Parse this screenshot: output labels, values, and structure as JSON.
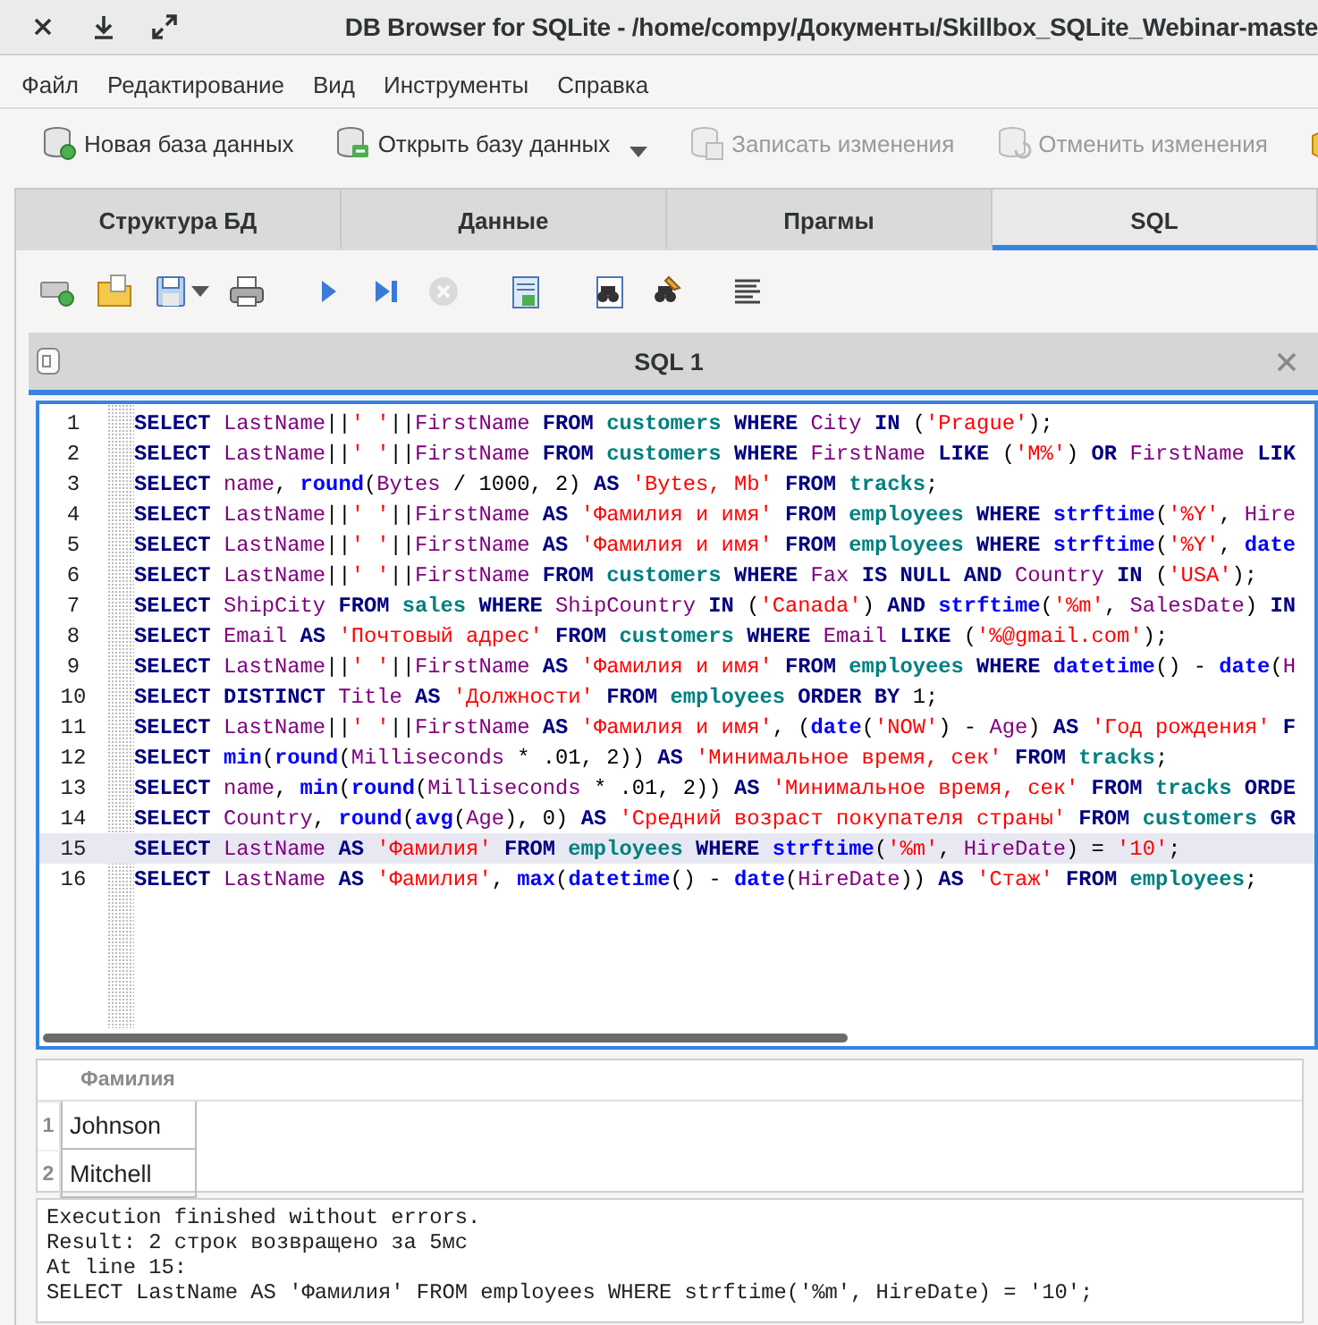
{
  "window": {
    "title": "DB Browser for SQLite - /home/compy/Документы/Skillbox_SQLite_Webinar-maste"
  },
  "menu": [
    "Файл",
    "Редактирование",
    "Вид",
    "Инструменты",
    "Справка"
  ],
  "toolbar": [
    {
      "kind": "new-db",
      "label": "Новая база данных",
      "disabled": false,
      "dropdown": false
    },
    {
      "kind": "open-db",
      "label": "Открыть базу данных",
      "disabled": false,
      "dropdown": true
    },
    {
      "kind": "write",
      "label": "Записать изменения",
      "disabled": true,
      "dropdown": false
    },
    {
      "kind": "revert",
      "label": "Отменить изменения",
      "disabled": true,
      "dropdown": false
    },
    {
      "kind": "project",
      "disabled": false,
      "dropdown": false
    }
  ],
  "tabs": [
    {
      "label": "Структура БД",
      "selected": false
    },
    {
      "label": "Данные",
      "selected": false
    },
    {
      "label": "Прагмы",
      "selected": false
    },
    {
      "label": "SQL",
      "selected": true
    }
  ],
  "editor_toolbar": [
    {
      "kind": "open-tab",
      "disabled": false,
      "dropdown": false
    },
    {
      "kind": "open-file",
      "disabled": false,
      "dropdown": false
    },
    {
      "kind": "save-file",
      "disabled": false,
      "dropdown": true
    },
    {
      "kind": "print",
      "disabled": false,
      "dropdown": false
    },
    {
      "kind": "execute",
      "disabled": false,
      "dropdown": false
    },
    {
      "kind": "execute-line",
      "disabled": false,
      "dropdown": false
    },
    {
      "kind": "stop",
      "disabled": true,
      "dropdown": false
    },
    {
      "kind": "save-results",
      "disabled": false,
      "dropdown": false
    },
    {
      "kind": "find",
      "disabled": false,
      "dropdown": false
    },
    {
      "kind": "replace",
      "disabled": false,
      "dropdown": false
    },
    {
      "kind": "comment",
      "disabled": false,
      "dropdown": false
    }
  ],
  "sql_tab": {
    "label": "SQL 1"
  },
  "editor": {
    "lines": [
      {
        "number": "1",
        "current": false,
        "tokens": [
          {
            "kind": "keyword",
            "text": "SELECT "
          },
          {
            "kind": "name",
            "text": "LastName"
          },
          {
            "kind": "plain",
            "text": "||"
          },
          {
            "kind": "string",
            "text": "' '"
          },
          {
            "kind": "plain",
            "text": "||"
          },
          {
            "kind": "name",
            "text": "FirstName "
          },
          {
            "kind": "keyword",
            "text": "FROM "
          },
          {
            "kind": "table",
            "text": "customers "
          },
          {
            "kind": "keyword",
            "text": "WHERE "
          },
          {
            "kind": "name",
            "text": "City "
          },
          {
            "kind": "keyword",
            "text": "IN "
          },
          {
            "kind": "plain",
            "text": "("
          },
          {
            "kind": "string",
            "text": "'Prague'"
          },
          {
            "kind": "plain",
            "text": ");"
          }
        ]
      },
      {
        "number": "2",
        "current": false,
        "tokens": [
          {
            "kind": "keyword",
            "text": "SELECT "
          },
          {
            "kind": "name",
            "text": "LastName"
          },
          {
            "kind": "plain",
            "text": "||"
          },
          {
            "kind": "string",
            "text": "' '"
          },
          {
            "kind": "plain",
            "text": "||"
          },
          {
            "kind": "name",
            "text": "FirstName "
          },
          {
            "kind": "keyword",
            "text": "FROM "
          },
          {
            "kind": "table",
            "text": "customers "
          },
          {
            "kind": "keyword",
            "text": "WHERE "
          },
          {
            "kind": "name",
            "text": "FirstName "
          },
          {
            "kind": "keyword",
            "text": "LIKE "
          },
          {
            "kind": "plain",
            "text": "("
          },
          {
            "kind": "string",
            "text": "'M%'"
          },
          {
            "kind": "plain",
            "text": ") "
          },
          {
            "kind": "keyword",
            "text": "OR "
          },
          {
            "kind": "name",
            "text": "FirstName "
          },
          {
            "kind": "keyword",
            "text": "LIK"
          }
        ]
      },
      {
        "number": "3",
        "current": false,
        "tokens": [
          {
            "kind": "keyword",
            "text": "SELECT "
          },
          {
            "kind": "name",
            "text": "name"
          },
          {
            "kind": "plain",
            "text": ", "
          },
          {
            "kind": "function",
            "text": "round"
          },
          {
            "kind": "plain",
            "text": "("
          },
          {
            "kind": "name",
            "text": "Bytes"
          },
          {
            "kind": "plain",
            "text": " / 1000, 2) "
          },
          {
            "kind": "keyword",
            "text": "AS "
          },
          {
            "kind": "string",
            "text": "'Bytes, Mb' "
          },
          {
            "kind": "keyword",
            "text": "FROM "
          },
          {
            "kind": "table",
            "text": "tracks"
          },
          {
            "kind": "plain",
            "text": ";"
          }
        ]
      },
      {
        "number": "4",
        "current": false,
        "tokens": [
          {
            "kind": "keyword",
            "text": "SELECT "
          },
          {
            "kind": "name",
            "text": "LastName"
          },
          {
            "kind": "plain",
            "text": "||"
          },
          {
            "kind": "string",
            "text": "' '"
          },
          {
            "kind": "plain",
            "text": "||"
          },
          {
            "kind": "name",
            "text": "FirstName "
          },
          {
            "kind": "keyword",
            "text": "AS "
          },
          {
            "kind": "string",
            "text": "'Фамилия и имя' "
          },
          {
            "kind": "keyword",
            "text": "FROM "
          },
          {
            "kind": "table",
            "text": "employees "
          },
          {
            "kind": "keyword",
            "text": "WHERE "
          },
          {
            "kind": "function",
            "text": "strftime"
          },
          {
            "kind": "plain",
            "text": "("
          },
          {
            "kind": "string",
            "text": "'%Y'"
          },
          {
            "kind": "plain",
            "text": ", "
          },
          {
            "kind": "name",
            "text": "Hire"
          }
        ]
      },
      {
        "number": "5",
        "current": false,
        "tokens": [
          {
            "kind": "keyword",
            "text": "SELECT "
          },
          {
            "kind": "name",
            "text": "LastName"
          },
          {
            "kind": "plain",
            "text": "||"
          },
          {
            "kind": "string",
            "text": "' '"
          },
          {
            "kind": "plain",
            "text": "||"
          },
          {
            "kind": "name",
            "text": "FirstName "
          },
          {
            "kind": "keyword",
            "text": "AS "
          },
          {
            "kind": "string",
            "text": "'Фамилия и имя' "
          },
          {
            "kind": "keyword",
            "text": "FROM "
          },
          {
            "kind": "table",
            "text": "employees "
          },
          {
            "kind": "keyword",
            "text": "WHERE "
          },
          {
            "kind": "function",
            "text": "strftime"
          },
          {
            "kind": "plain",
            "text": "("
          },
          {
            "kind": "string",
            "text": "'%Y'"
          },
          {
            "kind": "plain",
            "text": ", "
          },
          {
            "kind": "function",
            "text": "date"
          }
        ]
      },
      {
        "number": "6",
        "current": false,
        "tokens": [
          {
            "kind": "keyword",
            "text": "SELECT "
          },
          {
            "kind": "name",
            "text": "LastName"
          },
          {
            "kind": "plain",
            "text": "||"
          },
          {
            "kind": "string",
            "text": "' '"
          },
          {
            "kind": "plain",
            "text": "||"
          },
          {
            "kind": "name",
            "text": "FirstName "
          },
          {
            "kind": "keyword",
            "text": "FROM "
          },
          {
            "kind": "table",
            "text": "customers "
          },
          {
            "kind": "keyword",
            "text": "WHERE "
          },
          {
            "kind": "name",
            "text": "Fax "
          },
          {
            "kind": "keyword",
            "text": "IS NULL AND "
          },
          {
            "kind": "name",
            "text": "Country "
          },
          {
            "kind": "keyword",
            "text": "IN "
          },
          {
            "kind": "plain",
            "text": "("
          },
          {
            "kind": "string",
            "text": "'USA'"
          },
          {
            "kind": "plain",
            "text": ");"
          }
        ]
      },
      {
        "number": "7",
        "current": false,
        "tokens": [
          {
            "kind": "keyword",
            "text": "SELECT "
          },
          {
            "kind": "name",
            "text": "ShipCity "
          },
          {
            "kind": "keyword",
            "text": "FROM "
          },
          {
            "kind": "table",
            "text": "sales "
          },
          {
            "kind": "keyword",
            "text": "WHERE "
          },
          {
            "kind": "name",
            "text": "ShipCountry "
          },
          {
            "kind": "keyword",
            "text": "IN "
          },
          {
            "kind": "plain",
            "text": "("
          },
          {
            "kind": "string",
            "text": "'Canada'"
          },
          {
            "kind": "plain",
            "text": ") "
          },
          {
            "kind": "keyword",
            "text": "AND "
          },
          {
            "kind": "function",
            "text": "strftime"
          },
          {
            "kind": "plain",
            "text": "("
          },
          {
            "kind": "string",
            "text": "'%m'"
          },
          {
            "kind": "plain",
            "text": ", "
          },
          {
            "kind": "name",
            "text": "SalesDate"
          },
          {
            "kind": "plain",
            "text": ") "
          },
          {
            "kind": "keyword",
            "text": "IN"
          }
        ]
      },
      {
        "number": "8",
        "current": false,
        "tokens": [
          {
            "kind": "keyword",
            "text": "SELECT "
          },
          {
            "kind": "name",
            "text": "Email "
          },
          {
            "kind": "keyword",
            "text": "AS "
          },
          {
            "kind": "string",
            "text": "'Почтовый адрес' "
          },
          {
            "kind": "keyword",
            "text": "FROM "
          },
          {
            "kind": "table",
            "text": "customers "
          },
          {
            "kind": "keyword",
            "text": "WHERE "
          },
          {
            "kind": "name",
            "text": "Email "
          },
          {
            "kind": "keyword",
            "text": "LIKE "
          },
          {
            "kind": "plain",
            "text": "("
          },
          {
            "kind": "string",
            "text": "'%@gmail.com'"
          },
          {
            "kind": "plain",
            "text": ");"
          }
        ]
      },
      {
        "number": "9",
        "current": false,
        "tokens": [
          {
            "kind": "keyword",
            "text": "SELECT "
          },
          {
            "kind": "name",
            "text": "LastName"
          },
          {
            "kind": "plain",
            "text": "||"
          },
          {
            "kind": "string",
            "text": "' '"
          },
          {
            "kind": "plain",
            "text": "||"
          },
          {
            "kind": "name",
            "text": "FirstName "
          },
          {
            "kind": "keyword",
            "text": "AS "
          },
          {
            "kind": "string",
            "text": "'Фамилия и имя' "
          },
          {
            "kind": "keyword",
            "text": "FROM "
          },
          {
            "kind": "table",
            "text": "employees "
          },
          {
            "kind": "keyword",
            "text": "WHERE "
          },
          {
            "kind": "function",
            "text": "datetime"
          },
          {
            "kind": "plain",
            "text": "() - "
          },
          {
            "kind": "function",
            "text": "date"
          },
          {
            "kind": "plain",
            "text": "("
          },
          {
            "kind": "name",
            "text": "H"
          }
        ]
      },
      {
        "number": "10",
        "current": false,
        "tokens": [
          {
            "kind": "keyword",
            "text": "SELECT DISTINCT "
          },
          {
            "kind": "name",
            "text": "Title "
          },
          {
            "kind": "keyword",
            "text": "AS "
          },
          {
            "kind": "string",
            "text": "'Должности' "
          },
          {
            "kind": "keyword",
            "text": "FROM "
          },
          {
            "kind": "table",
            "text": "employees "
          },
          {
            "kind": "keyword",
            "text": "ORDER BY "
          },
          {
            "kind": "plain",
            "text": "1;"
          }
        ]
      },
      {
        "number": "11",
        "current": false,
        "tokens": [
          {
            "kind": "keyword",
            "text": "SELECT "
          },
          {
            "kind": "name",
            "text": "LastName"
          },
          {
            "kind": "plain",
            "text": "||"
          },
          {
            "kind": "string",
            "text": "' '"
          },
          {
            "kind": "plain",
            "text": "||"
          },
          {
            "kind": "name",
            "text": "FirstName "
          },
          {
            "kind": "keyword",
            "text": "AS "
          },
          {
            "kind": "string",
            "text": "'Фамилия и имя'"
          },
          {
            "kind": "plain",
            "text": ", ("
          },
          {
            "kind": "function",
            "text": "date"
          },
          {
            "kind": "plain",
            "text": "("
          },
          {
            "kind": "string",
            "text": "'NOW'"
          },
          {
            "kind": "plain",
            "text": ") - "
          },
          {
            "kind": "name",
            "text": "Age"
          },
          {
            "kind": "plain",
            "text": ") "
          },
          {
            "kind": "keyword",
            "text": "AS "
          },
          {
            "kind": "string",
            "text": "'Год рождения' "
          },
          {
            "kind": "keyword",
            "text": "F"
          }
        ]
      },
      {
        "number": "12",
        "current": false,
        "tokens": [
          {
            "kind": "keyword",
            "text": "SELECT "
          },
          {
            "kind": "function",
            "text": "min"
          },
          {
            "kind": "plain",
            "text": "("
          },
          {
            "kind": "function",
            "text": "round"
          },
          {
            "kind": "plain",
            "text": "("
          },
          {
            "kind": "name",
            "text": "Milliseconds"
          },
          {
            "kind": "plain",
            "text": " * .01, 2)) "
          },
          {
            "kind": "keyword",
            "text": "AS "
          },
          {
            "kind": "string",
            "text": "'Минимальное время, сек' "
          },
          {
            "kind": "keyword",
            "text": "FROM "
          },
          {
            "kind": "table",
            "text": "tracks"
          },
          {
            "kind": "plain",
            "text": ";"
          }
        ]
      },
      {
        "number": "13",
        "current": false,
        "tokens": [
          {
            "kind": "keyword",
            "text": "SELECT "
          },
          {
            "kind": "name",
            "text": "name"
          },
          {
            "kind": "plain",
            "text": ", "
          },
          {
            "kind": "function",
            "text": "min"
          },
          {
            "kind": "plain",
            "text": "("
          },
          {
            "kind": "function",
            "text": "round"
          },
          {
            "kind": "plain",
            "text": "("
          },
          {
            "kind": "name",
            "text": "Milliseconds"
          },
          {
            "kind": "plain",
            "text": " * .01, 2)) "
          },
          {
            "kind": "keyword",
            "text": "AS "
          },
          {
            "kind": "string",
            "text": "'Минимальное время, сек' "
          },
          {
            "kind": "keyword",
            "text": "FROM "
          },
          {
            "kind": "table",
            "text": "tracks "
          },
          {
            "kind": "keyword",
            "text": "ORDE"
          }
        ]
      },
      {
        "number": "14",
        "current": false,
        "tokens": [
          {
            "kind": "keyword",
            "text": "SELECT "
          },
          {
            "kind": "name",
            "text": "Country"
          },
          {
            "kind": "plain",
            "text": ", "
          },
          {
            "kind": "function",
            "text": "round"
          },
          {
            "kind": "plain",
            "text": "("
          },
          {
            "kind": "function",
            "text": "avg"
          },
          {
            "kind": "plain",
            "text": "("
          },
          {
            "kind": "name",
            "text": "Age"
          },
          {
            "kind": "plain",
            "text": "), 0) "
          },
          {
            "kind": "keyword",
            "text": "AS "
          },
          {
            "kind": "string",
            "text": "'Средний возраст покупателя страны' "
          },
          {
            "kind": "keyword",
            "text": "FROM "
          },
          {
            "kind": "table",
            "text": "customers "
          },
          {
            "kind": "keyword",
            "text": "GR"
          }
        ]
      },
      {
        "number": "15",
        "current": true,
        "tokens": [
          {
            "kind": "keyword",
            "text": "SELECT "
          },
          {
            "kind": "name",
            "text": "LastName "
          },
          {
            "kind": "keyword",
            "text": "AS "
          },
          {
            "kind": "string",
            "text": "'Фамилия' "
          },
          {
            "kind": "keyword",
            "text": "FROM "
          },
          {
            "kind": "table",
            "text": "employees "
          },
          {
            "kind": "keyword",
            "text": "WHERE "
          },
          {
            "kind": "function",
            "text": "strftime"
          },
          {
            "kind": "plain",
            "text": "("
          },
          {
            "kind": "string",
            "text": "'%m'"
          },
          {
            "kind": "plain",
            "text": ", "
          },
          {
            "kind": "name",
            "text": "HireDate"
          },
          {
            "kind": "plain",
            "text": ") = "
          },
          {
            "kind": "string",
            "text": "'10'"
          },
          {
            "kind": "plain",
            "text": ";"
          }
        ]
      },
      {
        "number": "16",
        "current": false,
        "tokens": [
          {
            "kind": "keyword",
            "text": "SELECT "
          },
          {
            "kind": "name",
            "text": "LastName "
          },
          {
            "kind": "keyword",
            "text": "AS "
          },
          {
            "kind": "string",
            "text": "'Фамилия'"
          },
          {
            "kind": "plain",
            "text": ", "
          },
          {
            "kind": "function",
            "text": "max"
          },
          {
            "kind": "plain",
            "text": "("
          },
          {
            "kind": "function",
            "text": "datetime"
          },
          {
            "kind": "plain",
            "text": "() - "
          },
          {
            "kind": "function",
            "text": "date"
          },
          {
            "kind": "plain",
            "text": "("
          },
          {
            "kind": "name",
            "text": "HireDate"
          },
          {
            "kind": "plain",
            "text": ")) "
          },
          {
            "kind": "keyword",
            "text": "AS "
          },
          {
            "kind": "string",
            "text": "'Стаж' "
          },
          {
            "kind": "keyword",
            "text": "FROM "
          },
          {
            "kind": "table",
            "text": "employees"
          },
          {
            "kind": "plain",
            "text": ";"
          }
        ]
      }
    ]
  },
  "results": {
    "columns": [
      "Фамилия"
    ],
    "rows": [
      {
        "number": "1",
        "cells": [
          "Johnson"
        ]
      },
      {
        "number": "2",
        "cells": [
          "Mitchell"
        ]
      }
    ]
  },
  "messages": [
    "Execution finished without errors.",
    "Result: 2 строк возвращено за 5мс",
    "At line 15:",
    "SELECT LastName AS 'Фамилия' FROM employees WHERE strftime('%m', HireDate) = '10';"
  ]
}
